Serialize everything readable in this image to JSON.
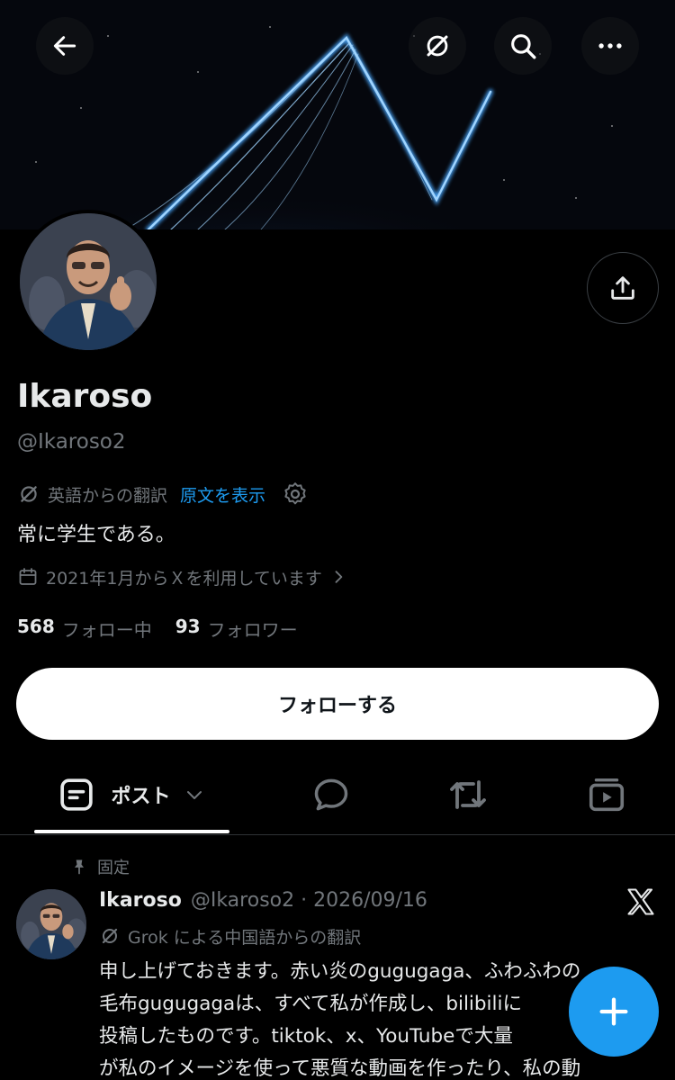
{
  "header": {
    "back_icon": "arrow-left-icon",
    "grok_icon": "grok-icon",
    "search_icon": "search-icon",
    "more_icon": "more-horizontal-icon"
  },
  "profile": {
    "name": "Ikaroso",
    "handle": "@Ikaroso2",
    "translation_label": "英語からの翻訳",
    "show_original": "原文を表示",
    "bio": "常に学生である。",
    "joined": "2021年1月からＸを利用しています",
    "following_count": "568",
    "following_label": "フォロー中",
    "followers_count": "93",
    "followers_label": "フォロワー",
    "follow_button": "フォローする"
  },
  "tabs": {
    "posts_label": "ポスト",
    "items": [
      "posts",
      "replies",
      "reposts",
      "media"
    ]
  },
  "pinned_tweet": {
    "pinned_label": "固定",
    "author_name": "Ikaroso",
    "author_meta": "@Ikaroso2 · 2026/09/16",
    "translation_label": "Grok による中国語からの翻訳",
    "lines": [
      "申し上げておきます。赤い炎のgugugaga、ふわふわの",
      "毛布gugugagaは、すべて私が作成し、bilibiliに",
      "投稿したものです。tiktok、x、YouTubeで大量",
      "が私のイメージを使って悪質な動画を作ったり、私の動"
    ]
  },
  "colors": {
    "accent": "#1d9bf0",
    "muted": "#71767b",
    "text": "#e7e9ea",
    "background": "#000000"
  }
}
